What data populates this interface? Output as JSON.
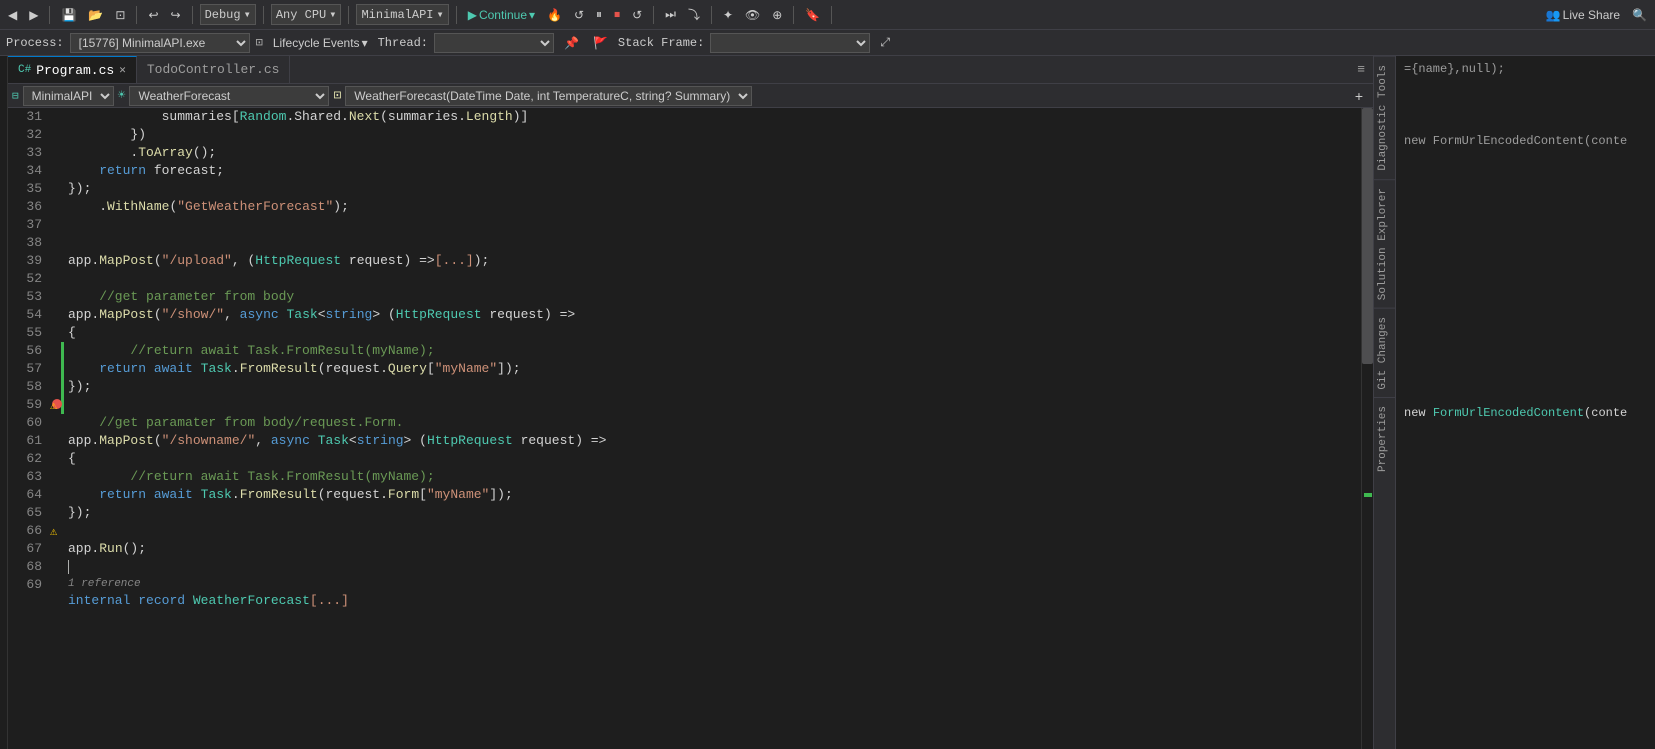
{
  "toolbar": {
    "back_btn": "◀",
    "forward_btn": "▶",
    "debug_mode": "Debug",
    "cpu_label": "Any CPU",
    "project_label": "MinimalAPI",
    "continue_btn": "Continue",
    "live_share_label": "Live Share",
    "icons": [
      "⊡",
      "⊟",
      "↩",
      "↪",
      "▶",
      "🔴",
      "↺",
      "⏸",
      "⏹",
      "↺",
      "⏭",
      "⤵",
      "✦",
      "⊕",
      "⊠",
      "⊞",
      "⊡",
      "🔖",
      "⊞",
      "⊡"
    ]
  },
  "process_bar": {
    "process_label": "Process:",
    "process_value": "[15776] MinimalAPI.exe",
    "lifecycle_events": "Lifecycle Events",
    "thread_label": "Thread:",
    "stack_frame_label": "Stack Frame:"
  },
  "tabs": [
    {
      "label": "Program.cs",
      "active": true,
      "has_close": true
    },
    {
      "label": "TodoController.cs",
      "active": false,
      "has_close": false
    }
  ],
  "nav_bar": {
    "project": "MinimalAPI",
    "class": "WeatherForecast",
    "member": "WeatherForecast(DateTime Date, int TemperatureC, string? Summary)"
  },
  "code_lines": [
    {
      "num": 31,
      "text": "            summaries[Random.Shared.Next(summaries.Length)]",
      "tokens": [
        {
          "t": "plain",
          "v": "            summaries["
        },
        {
          "t": "type",
          "v": "Random"
        },
        {
          "t": "plain",
          "v": ".Shared."
        },
        {
          "t": "method",
          "v": "Next"
        },
        {
          "t": "plain",
          "v": "(summaries."
        },
        {
          "t": "method",
          "v": "Length"
        },
        {
          "t": "plain",
          "v": ")]"
        }
      ]
    },
    {
      "num": 32,
      "text": "        })",
      "tokens": [
        {
          "t": "plain",
          "v": "        })"
        }
      ]
    },
    {
      "num": 33,
      "text": "        .ToArray();",
      "tokens": [
        {
          "t": "plain",
          "v": "        ."
        },
        {
          "t": "method",
          "v": "ToArray"
        },
        {
          "t": "plain",
          "v": "();"
        }
      ]
    },
    {
      "num": 34,
      "text": "    return forecast;",
      "tokens": [
        {
          "t": "kw",
          "v": "    return"
        },
        {
          "t": "plain",
          "v": " forecast;"
        }
      ]
    },
    {
      "num": 35,
      "text": "});",
      "tokens": [
        {
          "t": "plain",
          "v": "});"
        }
      ]
    },
    {
      "num": 36,
      "text": "    .WithName(\"GetWeatherForecast\");",
      "tokens": [
        {
          "t": "plain",
          "v": "    ."
        },
        {
          "t": "method",
          "v": "WithName"
        },
        {
          "t": "plain",
          "v": "("
        },
        {
          "t": "str",
          "v": "\"GetWeatherForecast\""
        },
        {
          "t": "plain",
          "v": ");"
        }
      ]
    },
    {
      "num": 37,
      "text": "",
      "tokens": []
    },
    {
      "num": 38,
      "text": "",
      "tokens": []
    },
    {
      "num": 39,
      "text": "app.MapPost(\"/upload\", (HttpRequest request) =>[...]);",
      "tokens": [
        {
          "t": "plain",
          "v": "app."
        },
        {
          "t": "method",
          "v": "MapPost"
        },
        {
          "t": "plain",
          "v": "("
        },
        {
          "t": "str",
          "v": "\"/upload\""
        },
        {
          "t": "plain",
          "v": ", ("
        },
        {
          "t": "type",
          "v": "HttpRequest"
        },
        {
          "t": "plain",
          "v": " request) =>"
        },
        {
          "t": "str",
          "v": "[...]"
        },
        {
          "t": "plain",
          "v": ");"
        }
      ],
      "collapsed": true
    },
    {
      "num": 52,
      "text": "",
      "tokens": [],
      "spacer": true
    },
    {
      "num": 53,
      "text": "    //get parameter from body",
      "tokens": [
        {
          "t": "comment",
          "v": "    //get parameter from body"
        }
      ]
    },
    {
      "num": 54,
      "text": "app.MapPost(\"/show/\", async Task<string> (HttpRequest request) =>",
      "tokens": [
        {
          "t": "plain",
          "v": "app."
        },
        {
          "t": "method",
          "v": "MapPost"
        },
        {
          "t": "plain",
          "v": "("
        },
        {
          "t": "str",
          "v": "\"/show/\""
        },
        {
          "t": "plain",
          "v": ", "
        },
        {
          "t": "kw",
          "v": "async"
        },
        {
          "t": "plain",
          "v": " "
        },
        {
          "t": "type",
          "v": "Task"
        },
        {
          "t": "plain",
          "v": "<"
        },
        {
          "t": "kw",
          "v": "string"
        },
        {
          "t": "plain",
          "v": "> ("
        },
        {
          "t": "type",
          "v": "HttpRequest"
        },
        {
          "t": "plain",
          "v": " request) =>"
        }
      ],
      "has_collapse": true
    },
    {
      "num": 55,
      "text": "{",
      "tokens": [
        {
          "t": "plain",
          "v": "{"
        }
      ]
    },
    {
      "num": 56,
      "text": "        //return await Task.FromResult(myName);",
      "tokens": [
        {
          "t": "comment",
          "v": "        //return await Task.FromResult(myName);"
        }
      ]
    },
    {
      "num": 57,
      "text": "    return await Task.FromResult(request.Query[\"myName\"]);",
      "tokens": [
        {
          "t": "kw",
          "v": "    return"
        },
        {
          "t": "plain",
          "v": " "
        },
        {
          "t": "kw",
          "v": "await"
        },
        {
          "t": "plain",
          "v": " "
        },
        {
          "t": "type",
          "v": "Task"
        },
        {
          "t": "plain",
          "v": "."
        },
        {
          "t": "method",
          "v": "FromResult"
        },
        {
          "t": "plain",
          "v": "(request."
        },
        {
          "t": "method",
          "v": "Query"
        },
        {
          "t": "plain",
          "v": "["
        },
        {
          "t": "str",
          "v": "\"myName\""
        },
        {
          "t": "plain",
          "v": "]);"
        }
      ]
    },
    {
      "num": 58,
      "text": "});",
      "tokens": [
        {
          "t": "plain",
          "v": "});"
        }
      ]
    },
    {
      "num": 59,
      "text": "",
      "tokens": []
    },
    {
      "num": 60,
      "text": "    //get paramater from body/request.Form.",
      "tokens": [
        {
          "t": "comment",
          "v": "    //get paramater from body/request.Form."
        }
      ]
    },
    {
      "num": 61,
      "text": "app.MapPost(\"/showname/\", async Task<string> (HttpRequest request) =>",
      "tokens": [
        {
          "t": "plain",
          "v": "app."
        },
        {
          "t": "method",
          "v": "MapPost"
        },
        {
          "t": "plain",
          "v": "("
        },
        {
          "t": "str",
          "v": "\"/showname/\""
        },
        {
          "t": "plain",
          "v": ", "
        },
        {
          "t": "kw",
          "v": "async"
        },
        {
          "t": "plain",
          "v": " "
        },
        {
          "t": "type",
          "v": "Task"
        },
        {
          "t": "plain",
          "v": "<"
        },
        {
          "t": "kw",
          "v": "string"
        },
        {
          "t": "plain",
          "v": "> ("
        },
        {
          "t": "type",
          "v": "HttpRequest"
        },
        {
          "t": "plain",
          "v": " request) =>"
        }
      ],
      "has_collapse": true,
      "breakpoint_offset": 0
    },
    {
      "num": 62,
      "text": "{",
      "tokens": [
        {
          "t": "plain",
          "v": "{"
        }
      ]
    },
    {
      "num": 63,
      "text": "        //return await Task.FromResult(myName);",
      "tokens": [
        {
          "t": "comment",
          "v": "        //return await Task.FromResult(myName);"
        }
      ]
    },
    {
      "num": 64,
      "text": "    return await Task.FromResult(request.Form[\"myName\"]);",
      "tokens": [
        {
          "t": "kw",
          "v": "    return"
        },
        {
          "t": "plain",
          "v": " "
        },
        {
          "t": "kw",
          "v": "await"
        },
        {
          "t": "plain",
          "v": " "
        },
        {
          "t": "type",
          "v": "Task"
        },
        {
          "t": "plain",
          "v": "."
        },
        {
          "t": "method",
          "v": "FromResult"
        },
        {
          "t": "plain",
          "v": "(request."
        },
        {
          "t": "method",
          "v": "Form"
        },
        {
          "t": "plain",
          "v": "["
        },
        {
          "t": "str",
          "v": "\"myName\""
        },
        {
          "t": "plain",
          "v": "]);"
        }
      ]
    },
    {
      "num": 65,
      "text": "});",
      "tokens": [
        {
          "t": "plain",
          "v": "});"
        }
      ]
    },
    {
      "num": 66,
      "text": "",
      "tokens": []
    },
    {
      "num": 67,
      "text": "app.Run();",
      "tokens": [
        {
          "t": "plain",
          "v": "app."
        },
        {
          "t": "method",
          "v": "Run"
        },
        {
          "t": "plain",
          "v": "();"
        }
      ]
    },
    {
      "num": 68,
      "text": "",
      "tokens": [],
      "has_bookmark": true
    },
    {
      "num": 69,
      "text": "internal record WeatherForecast[...]",
      "tokens": [
        {
          "t": "kw",
          "v": "internal"
        },
        {
          "t": "plain",
          "v": " "
        },
        {
          "t": "kw",
          "v": "record"
        },
        {
          "t": "plain",
          "v": " "
        },
        {
          "t": "type",
          "v": "WeatherForecast"
        },
        {
          "t": "str",
          "v": "[...]"
        }
      ],
      "ref_count": "1 reference",
      "has_collapse": true
    }
  ],
  "sidebar_tabs": [
    {
      "label": "Diagnostic Tools"
    },
    {
      "label": "Solution Explorer"
    },
    {
      "label": "Git Changes"
    },
    {
      "label": "Properties"
    }
  ],
  "right_panel_code": [
    "={name},null);",
    "",
    "",
    "",
    "new FormUrlEncodedContent(conte"
  ],
  "colors": {
    "accent": "#007acc",
    "bg_main": "#1e1e1e",
    "bg_toolbar": "#2d2d30",
    "bg_tab_active": "#1e1e1e",
    "bg_tab_inactive": "#2d2d30",
    "green_bar": "#3fb950",
    "breakpoint": "#e5534b"
  }
}
